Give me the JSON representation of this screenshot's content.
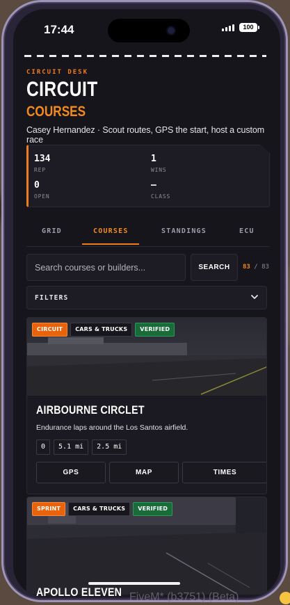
{
  "status": {
    "time": "17:44",
    "battery": "100"
  },
  "header": {
    "kicker": "CIRCUIT DESK",
    "title": "CIRCUIT",
    "subtitle_title": "COURSES",
    "subtitle": "Casey Hernandez · Scout routes, GPS the start, host a custom race"
  },
  "stats": [
    {
      "value": "134",
      "label": "REP"
    },
    {
      "value": "1",
      "label": "WINS"
    },
    {
      "value": "0",
      "label": "OPEN"
    },
    {
      "value": "—",
      "label": "CLASS"
    }
  ],
  "tabs": [
    {
      "label": "GRID",
      "active": false
    },
    {
      "label": "COURSES",
      "active": true
    },
    {
      "label": "STANDINGS",
      "active": false
    },
    {
      "label": "ECU",
      "active": false
    }
  ],
  "search": {
    "placeholder": "Search courses or builders...",
    "button": "SEARCH",
    "count_shown": "83",
    "count_total": "/ 83"
  },
  "filters": {
    "label": "FILTERS"
  },
  "courses": [
    {
      "badges": [
        "CIRCUIT",
        "CARS & TRUCKS",
        "VERIFIED"
      ],
      "name": "AIRBOURNE CIRCLET",
      "description": "Endurance laps around the Los Santos airfield.",
      "chips": [
        "0",
        "5.1 mi",
        "2.5 mi"
      ],
      "actions": [
        "GPS",
        "MAP",
        "TIMES"
      ]
    },
    {
      "badges": [
        "SPRINT",
        "CARS & TRUCKS",
        "VERIFIED"
      ],
      "name": "APOLLO ELEVEN"
    }
  ],
  "overlay": {
    "watermark": "FiveM* (b3751) (Beta)"
  },
  "colors": {
    "accent": "#f07d1c",
    "verified": "#1a6b3a",
    "background": "#16151c"
  }
}
